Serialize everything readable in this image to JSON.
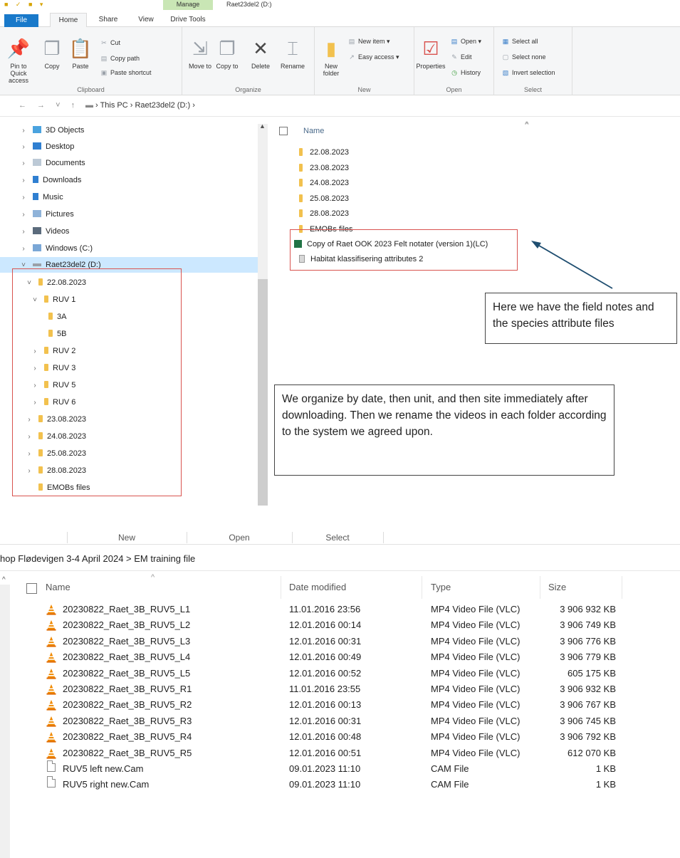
{
  "shot1": {
    "title": {
      "manage_tab": "Manage",
      "window_title": "Raet23del2 (D:)"
    },
    "tabs": [
      "File",
      "Home",
      "Share",
      "View",
      "Drive Tools"
    ],
    "ribbon": {
      "clipboard": {
        "pin": "Pin to Quick access",
        "copy": "Copy",
        "paste": "Paste",
        "cut": "Cut",
        "copy_path": "Copy path",
        "paste_shortcut": "Paste shortcut",
        "label": "Clipboard"
      },
      "organize": {
        "move_to": "Move to",
        "copy_to": "Copy to",
        "delete": "Delete",
        "rename": "Rename",
        "label": "Organize"
      },
      "new": {
        "new_folder": "New folder",
        "new_item": "New item",
        "easy_access": "Easy access",
        "label": "New"
      },
      "open": {
        "properties": "Properties",
        "open": "Open",
        "edit": "Edit",
        "history": "History",
        "label": "Open"
      },
      "select": {
        "select_all": "Select all",
        "select_none": "Select none",
        "invert_selection": "Invert selection",
        "label": "Select"
      }
    },
    "address": {
      "crumb1": "This PC",
      "crumb2": "Raet23del2 (D:)"
    },
    "nav": {
      "items": [
        "3D Objects",
        "Desktop",
        "Documents",
        "Downloads",
        "Music",
        "Pictures",
        "Videos",
        "Windows (C:)",
        "Raet23del2 (D:)",
        "22.08.2023",
        "RUV 1",
        "3A",
        "5B",
        "RUV 2",
        "RUV 3",
        "RUV 5",
        "RUV 6",
        "23.08.2023",
        "24.08.2023",
        "25.08.2023",
        "28.08.2023",
        "EMOBs files"
      ]
    },
    "list": {
      "header_name": "Name",
      "items": [
        "22.08.2023",
        "23.08.2023",
        "24.08.2023",
        "25.08.2023",
        "28.08.2023",
        "EMOBs files",
        "Copy of Raet OOK 2023 Felt notater (version 1)(LC)",
        "Habitat klassifisering attributes 2"
      ]
    },
    "callout1": "Here we have the field notes and the species attribute files",
    "callout2": "We organize by date, then unit, and then site immediately after downloading. Then we rename the videos in each folder according to the system we agreed upon.",
    "colors": {
      "accent": "#1979ca",
      "folder": "#f2c14e",
      "highlight_box": "#d9534f",
      "selection": "#cce8ff"
    }
  },
  "shot2": {
    "ribbon_labels": [
      "New",
      "Open",
      "Select"
    ],
    "address": "hop Flødevigen 3-4 April 2024  >  EM training file",
    "headers": {
      "name": "Name",
      "date": "Date modified",
      "type": "Type",
      "size": "Size"
    },
    "rows": [
      {
        "name": "20230822_Raet_3B_RUV5_L1",
        "date": "11.01.2016 23:56",
        "type": "MP4 Video File (VLC)",
        "size": "3 906 932 KB",
        "icon": "vlc-icon"
      },
      {
        "name": "20230822_Raet_3B_RUV5_L2",
        "date": "12.01.2016 00:14",
        "type": "MP4 Video File (VLC)",
        "size": "3 906 749 KB",
        "icon": "vlc-icon"
      },
      {
        "name": "20230822_Raet_3B_RUV5_L3",
        "date": "12.01.2016 00:31",
        "type": "MP4 Video File (VLC)",
        "size": "3 906 776 KB",
        "icon": "vlc-icon"
      },
      {
        "name": "20230822_Raet_3B_RUV5_L4",
        "date": "12.01.2016 00:49",
        "type": "MP4 Video File (VLC)",
        "size": "3 906 779 KB",
        "icon": "vlc-icon"
      },
      {
        "name": "20230822_Raet_3B_RUV5_L5",
        "date": "12.01.2016 00:52",
        "type": "MP4 Video File (VLC)",
        "size": "605 175 KB",
        "icon": "vlc-icon"
      },
      {
        "name": "20230822_Raet_3B_RUV5_R1",
        "date": "11.01.2016 23:55",
        "type": "MP4 Video File (VLC)",
        "size": "3 906 932 KB",
        "icon": "vlc-icon"
      },
      {
        "name": "20230822_Raet_3B_RUV5_R2",
        "date": "12.01.2016 00:13",
        "type": "MP4 Video File (VLC)",
        "size": "3 906 767 KB",
        "icon": "vlc-icon"
      },
      {
        "name": "20230822_Raet_3B_RUV5_R3",
        "date": "12.01.2016 00:31",
        "type": "MP4 Video File (VLC)",
        "size": "3 906 745 KB",
        "icon": "vlc-icon"
      },
      {
        "name": "20230822_Raet_3B_RUV5_R4",
        "date": "12.01.2016 00:48",
        "type": "MP4 Video File (VLC)",
        "size": "3 906 792 KB",
        "icon": "vlc-icon"
      },
      {
        "name": "20230822_Raet_3B_RUV5_R5",
        "date": "12.01.2016 00:51",
        "type": "MP4 Video File (VLC)",
        "size": "612 070 KB",
        "icon": "vlc-icon"
      },
      {
        "name": "RUV5 left new.Cam",
        "date": "09.01.2023 11:10",
        "type": "CAM File",
        "size": "1 KB",
        "icon": "file-icon"
      },
      {
        "name": "RUV5 right new.Cam",
        "date": "09.01.2023 11:10",
        "type": "CAM File",
        "size": "1 KB",
        "icon": "file-icon"
      }
    ]
  }
}
